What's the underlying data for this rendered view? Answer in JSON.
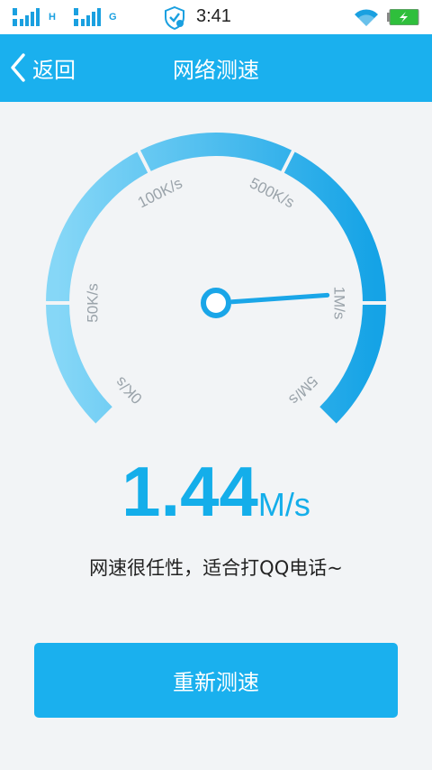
{
  "status_bar": {
    "sim1_network": "H",
    "sim2_network": "G",
    "time": "3:41"
  },
  "header": {
    "back_label": "返回",
    "title": "网络测速"
  },
  "gauge": {
    "tick_labels": [
      "0K/s",
      "50K/s",
      "100K/s",
      "500K/s",
      "1M/s",
      "5M/s"
    ]
  },
  "result": {
    "speed_value": "1.44",
    "speed_unit": "M/s",
    "comment": "网速很任性，适合打QQ电话~"
  },
  "actions": {
    "retest_label": "重新测速"
  },
  "colors": {
    "accent": "#1ab0ee",
    "gauge_light": "#7fd3f6",
    "gauge_dark": "#1aa6e8",
    "background": "#f2f4f6"
  }
}
